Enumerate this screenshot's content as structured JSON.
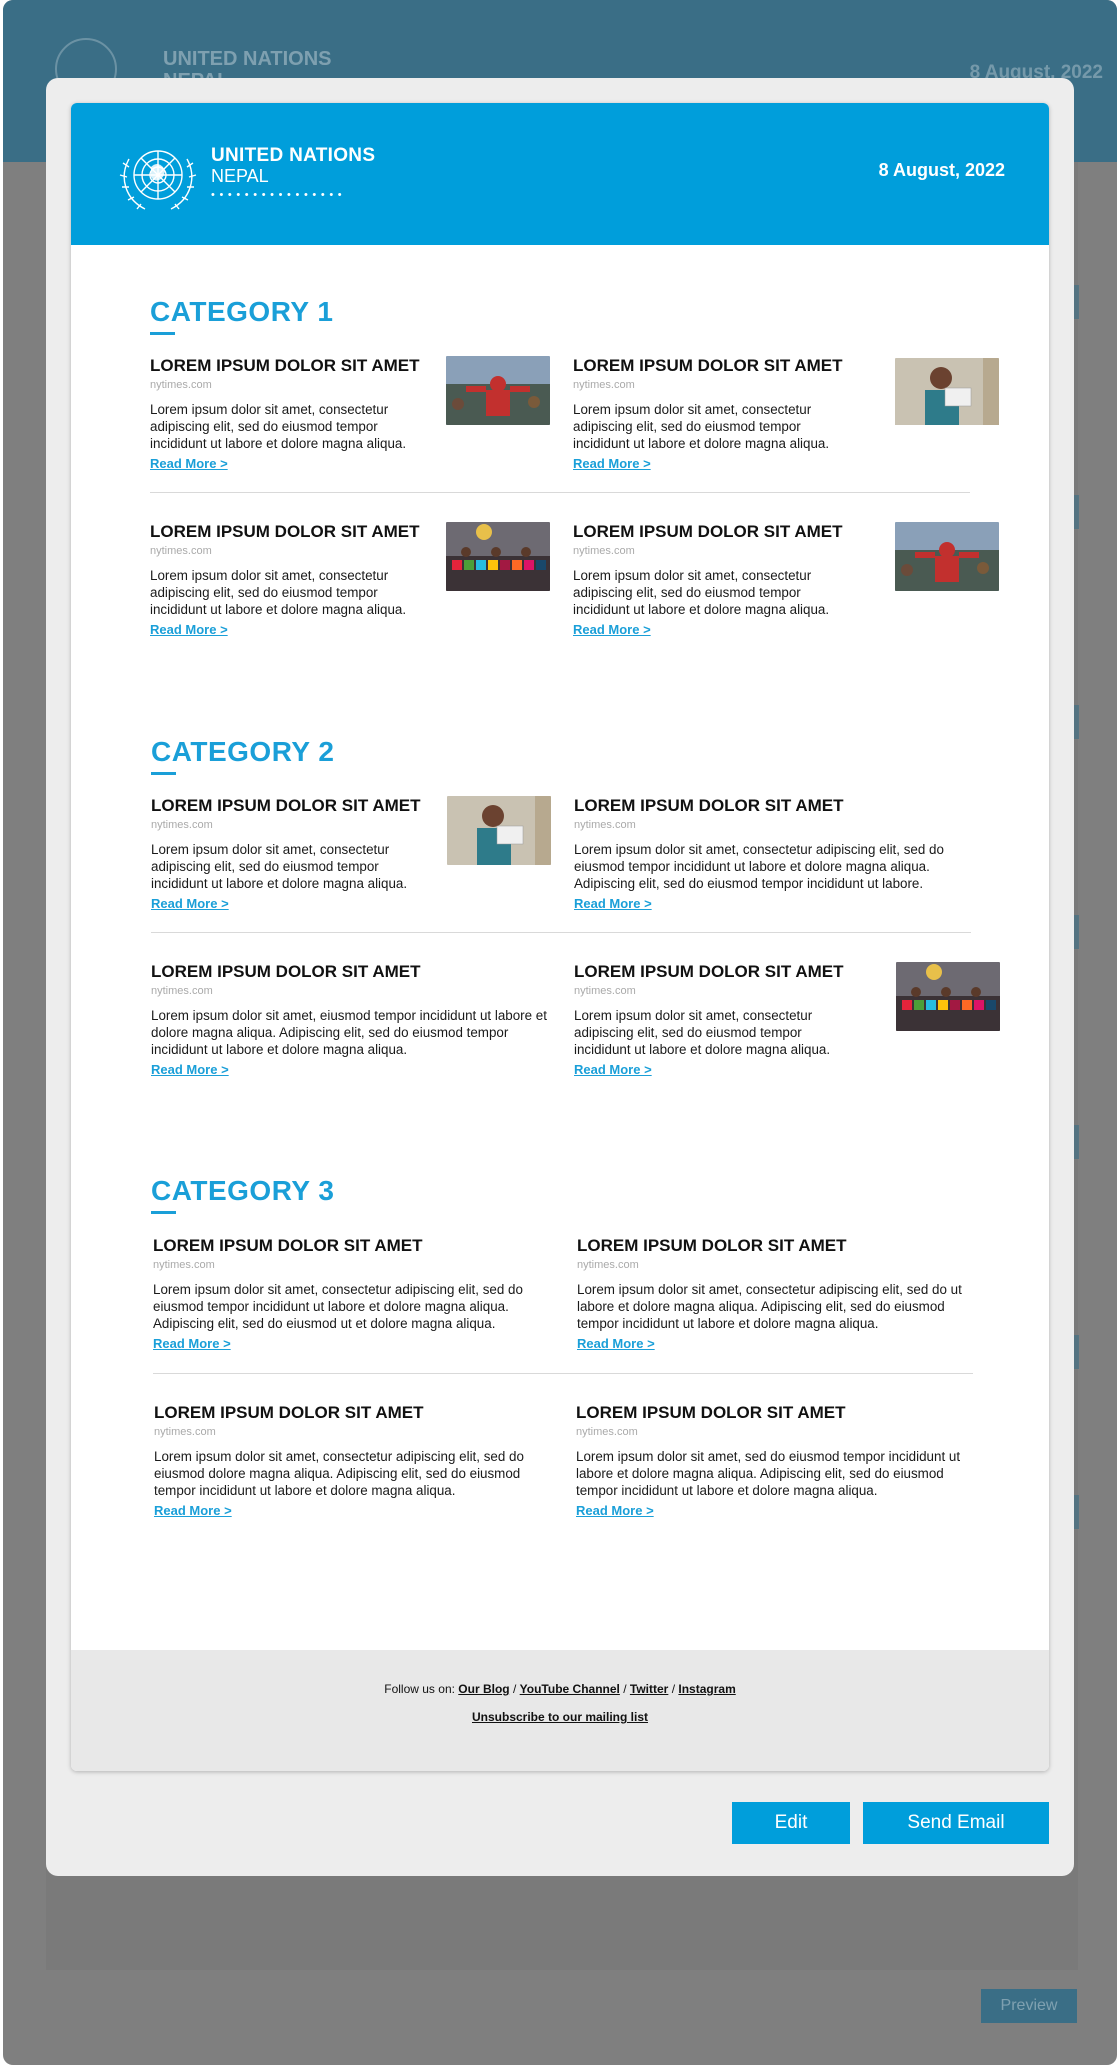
{
  "background": {
    "brand_line1": "UNITED NATIONS",
    "brand_line2": "NEPAL",
    "date": "8 August, 2022",
    "preview_label": "Preview"
  },
  "header": {
    "brand_line1": "UNITED NATIONS",
    "brand_line2": "NEPAL",
    "brand_dots": "••••••••••••••••",
    "date": "8 August, 2022"
  },
  "categories": [
    {
      "title": "CATEGORY 1",
      "articles": [
        {
          "title": "LOREM IPSUM DOLOR SIT AMET",
          "source": "nytimes.com",
          "body": "Lorem ipsum dolor sit amet, consectetur adipiscing elit, sed do eiusmod tempor incididunt ut labore et dolore magna aliqua.",
          "link": "Read More >",
          "image": "photo-person-crowd"
        },
        {
          "title": "LOREM IPSUM DOLOR SIT AMET",
          "source": "nytimes.com",
          "body": "Lorem ipsum dolor sit amet, consectetur adipiscing elit, sed do eiusmod tempor incididunt ut labore et dolore magna aliqua.",
          "link": "Read More >",
          "image": "photo-woman-card"
        },
        {
          "title": "LOREM IPSUM DOLOR SIT AMET",
          "source": "nytimes.com",
          "body": "Lorem ipsum dolor sit amet, consectetur adipiscing elit, sed do eiusmod tempor incididunt ut labore et dolore magna aliqua.",
          "link": "Read More >",
          "image": "photo-group-sdg"
        },
        {
          "title": "LOREM IPSUM DOLOR SIT AMET",
          "source": "nytimes.com",
          "body": "Lorem ipsum dolor sit amet, consectetur adipiscing elit, sed do eiusmod tempor incididunt ut labore et dolore magna aliqua.",
          "link": "Read More >",
          "image": "photo-person-crowd"
        }
      ]
    },
    {
      "title": "CATEGORY 2",
      "articles": [
        {
          "title": "LOREM IPSUM DOLOR SIT AMET",
          "source": "nytimes.com",
          "body": "Lorem ipsum dolor sit amet, consectetur adipiscing elit, sed do eiusmod tempor incididunt ut labore et dolore magna aliqua.",
          "link": "Read More >",
          "image": "photo-woman-card"
        },
        {
          "title": "LOREM IPSUM DOLOR SIT AMET",
          "source": "nytimes.com",
          "body": "Lorem ipsum dolor sit amet, consectetur adipiscing elit, sed do eiusmod tempor incididunt ut labore et dolore magna aliqua. Adipiscing elit, sed do eiusmod tempor incididunt ut labore.",
          "link": "Read More >"
        },
        {
          "title": "LOREM IPSUM DOLOR SIT AMET",
          "source": "nytimes.com",
          "body": "Lorem ipsum dolor sit amet,  eiusmod tempor incididunt ut labore et dolore magna aliqua. Adipiscing elit, sed do eiusmod tempor incididunt ut labore et dolore magna aliqua.",
          "link": "Read More >"
        },
        {
          "title": "LOREM IPSUM DOLOR SIT AMET",
          "source": "nytimes.com",
          "body": "Lorem ipsum dolor sit amet, consectetur adipiscing elit, sed do eiusmod tempor incididunt ut labore et dolore magna aliqua.",
          "link": "Read More >",
          "image": "photo-group-sdg"
        }
      ]
    },
    {
      "title": "CATEGORY 3",
      "articles": [
        {
          "title": "LOREM IPSUM DOLOR SIT AMET",
          "source": "nytimes.com",
          "body": "Lorem ipsum dolor sit amet, consectetur adipiscing elit, sed do eiusmod tempor incididunt ut labore et dolore magna aliqua. Adipiscing elit, sed do eiusmod ut  et dolore magna aliqua.",
          "link": "Read More >"
        },
        {
          "title": "LOREM IPSUM DOLOR SIT AMET",
          "source": "nytimes.com",
          "body": "Lorem ipsum dolor sit amet, consectetur adipiscing elit, sed do ut labore et dolore magna aliqua. Adipiscing elit, sed do eiusmod tempor incididunt ut labore et dolore magna aliqua.",
          "link": "Read More >"
        },
        {
          "title": "LOREM IPSUM DOLOR SIT AMET",
          "source": "nytimes.com",
          "body": "Lorem ipsum dolor sit amet, consectetur adipiscing elit, sed do eiusmod dolore magna aliqua. Adipiscing elit, sed do eiusmod tempor incididunt ut labore et dolore magna aliqua.",
          "link": "Read More >"
        },
        {
          "title": "LOREM IPSUM DOLOR SIT AMET",
          "source": "nytimes.com",
          "body": "Lorem ipsum dolor sit amet, sed do eiusmod tempor incididunt ut labore et dolore magna aliqua. Adipiscing elit, sed do eiusmod tempor incididunt ut labore et dolore magna aliqua.",
          "link": "Read More >"
        }
      ]
    }
  ],
  "footer": {
    "follow_prefix": "Follow us on:",
    "links": [
      "Our Blog",
      "YouTube Channel",
      "Twitter",
      "Instagram"
    ],
    "separator": "/",
    "unsubscribe": "Unsubscribe to our mailing list"
  },
  "actions": {
    "edit_label": "Edit",
    "send_label": "Send Email"
  },
  "colors": {
    "accent": "#009edb",
    "category_title": "#1a9fd8",
    "overlay": "#7f7f7f",
    "modal_bg": "#ededed",
    "footer_bg": "#e8e8e8"
  }
}
